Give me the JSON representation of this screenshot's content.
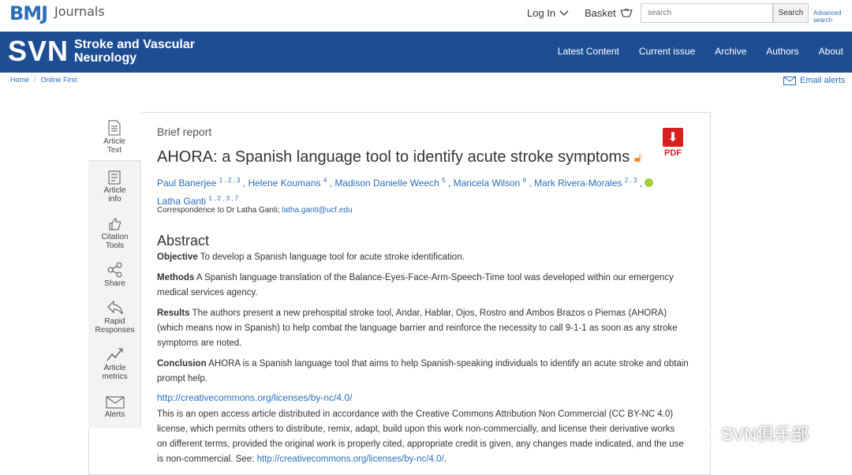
{
  "header": {
    "logo": "BMJ",
    "logo_sub": "Journals",
    "login": "Log In",
    "basket": "Basket",
    "search_placeholder": "search",
    "search_button": "Search",
    "advanced_search": "Advanced search"
  },
  "journal": {
    "abbr": "SVN",
    "name_line1": "Stroke and Vascular",
    "name_line2": "Neurology",
    "nav": [
      "Latest Content",
      "Current issue",
      "Archive",
      "Authors",
      "About"
    ]
  },
  "breadcrumb": [
    "Home",
    "Online First"
  ],
  "email_alerts": "Email alerts",
  "sidebar": [
    {
      "label1": "Article",
      "label2": "Text",
      "icon": "document-icon"
    },
    {
      "label1": "Article",
      "label2": "info",
      "icon": "info-icon"
    },
    {
      "label1": "Citation",
      "label2": "Tools",
      "icon": "thumb-icon"
    },
    {
      "label1": "Share",
      "label2": "",
      "icon": "share-icon"
    },
    {
      "label1": "Rapid",
      "label2": "Responses",
      "icon": "reply-icon"
    },
    {
      "label1": "Article",
      "label2": "metrics",
      "icon": "chart-icon"
    },
    {
      "label1": "Alerts",
      "label2": "",
      "icon": "envelope-icon"
    }
  ],
  "article": {
    "type": "Brief report",
    "title": "AHORA: a Spanish language tool to identify acute stroke symptoms",
    "pdf_label": "PDF",
    "authors": [
      {
        "name": "Paul Banerjee",
        "sup": "1 , 2 , 3"
      },
      {
        "name": "Helene Koumans",
        "sup": "4"
      },
      {
        "name": "Madison Danielle Weech",
        "sup": "5"
      },
      {
        "name": "Maricela Wilson",
        "sup": "6"
      },
      {
        "name": "Mark Rivera-Morales",
        "sup": "2 , 3"
      },
      {
        "name": "Latha Ganti",
        "sup": "1 , 2 , 3 , 7"
      }
    ],
    "correspondence_label": "Correspondence to Dr Latha Ganti;",
    "correspondence_email": "latha.ganti@ucf.edu",
    "abstract_heading": "Abstract",
    "objective_label": "Objective",
    "objective_text": "To develop a Spanish language tool for acute stroke identification.",
    "methods_label": "Methods",
    "methods_text": "A Spanish language translation of the Balance-Eyes-Face-Arm-Speech-Time tool was developed within our emergency medical services agency.",
    "results_label": "Results",
    "results_text": "The authors present a new prehospital stroke tool, Andar, Hablar, Ojos, Rostro and Ambos Brazos o Piernas (AHORA) (which means now in Spanish) to help combat the language barrier and reinforce the necessity to call 9-1-1 as soon as any stroke symptoms are noted.",
    "conclusion_label": "Conclusion",
    "conclusion_text": "AHORA is a Spanish language tool that aims to help Spanish-speaking individuals to identify an acute stroke and obtain prompt help.",
    "cc_link": "http://creativecommons.org/licenses/by-nc/4.0/",
    "license_text": "This is an open access article distributed in accordance with the Creative Commons Attribution Non Commercial (CC BY-NC 4.0) license, which permits others to distribute, remix, adapt, build upon this work non-commercially, and license their derivative works on different terms, provided the original work is properly cited, appropriate credit is given, any changes made indicated, and the use is non-commercial. See:",
    "license_link": "http://creativecommons.org/licenses/by-nc/4.0/"
  },
  "watermark": "SVN俱乐部",
  "colors": {
    "brand_blue": "#1d4e94",
    "link": "#2a6ebb",
    "pdf_red": "#d81e1e",
    "open_access": "#f28a30"
  }
}
